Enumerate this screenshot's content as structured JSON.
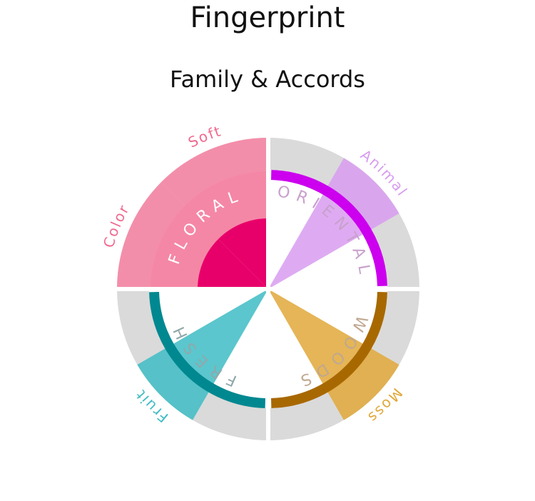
{
  "header": {
    "title": "Fingerprint",
    "subtitle": "Family & Accords"
  },
  "chart_data": {
    "type": "radial-bar",
    "title": "Fingerprint",
    "subtitle": "Family & Accords",
    "track_color": "#dadada",
    "families": [
      {
        "name": "FLORAL",
        "start_deg": 270,
        "end_deg": 360,
        "strength": 1.0,
        "color": "#e8006a",
        "ring": false,
        "label_color": "#ffffff",
        "accords": [
          {
            "name": "Color",
            "value": 1.0,
            "color": "#f48aa8"
          },
          {
            "name": "Soft",
            "value": 1.0,
            "color": "#f48aa8"
          }
        ]
      },
      {
        "name": "ORIENTAL",
        "start_deg": 0,
        "end_deg": 90,
        "strength": 0.4,
        "color": "#cc00ee",
        "ring": true,
        "label_color": "#c8a0cc",
        "accords": [
          {
            "name": "Animal",
            "value": 1.0,
            "color": "#d89cf0"
          }
        ]
      },
      {
        "name": "WOODS",
        "start_deg": 90,
        "end_deg": 180,
        "strength": 0.2,
        "color": "#a86800",
        "ring": true,
        "label_color": "#c0a890",
        "accords": [
          {
            "name": "Moss",
            "value": 1.0,
            "color": "#e0a83a"
          }
        ]
      },
      {
        "name": "FRESH",
        "start_deg": 180,
        "end_deg": 270,
        "strength": 0.4,
        "color": "#008890",
        "ring": true,
        "label_color": "#90a8aa",
        "accords": [
          {
            "name": "Fruit",
            "value": 1.0,
            "color": "#3ebcc4"
          }
        ]
      }
    ]
  }
}
